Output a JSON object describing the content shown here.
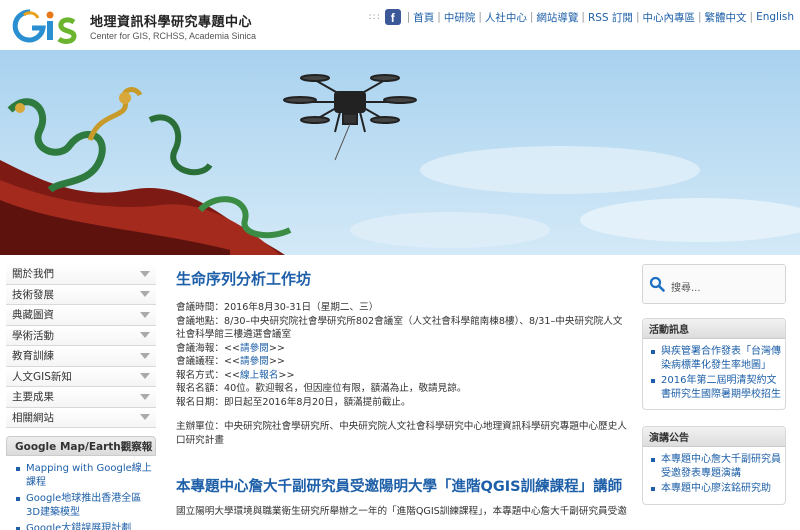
{
  "header": {
    "logo_text": "GIS",
    "title": "地理資訊科學研究專題中心",
    "subtitle": "Center for GIS, RCHSS, Academia Sinica",
    "nav": [
      "首頁",
      "中研院",
      "人社中心",
      "網站導覽",
      "RSS 訂閱",
      "中心內專區",
      "繁體中文",
      "English"
    ]
  },
  "left_menu": [
    "關於我們",
    "技術發展",
    "典藏圖資",
    "學術活動",
    "教育訓練",
    "人文GIS新知",
    "主要成果",
    "相關網站"
  ],
  "gmap": {
    "title": "Google Map/Earth觀察報",
    "items": [
      "Mapping with Google線上課程",
      "Google地球推出香港全區3D建築模型",
      "Google大錯誤展現計劃"
    ]
  },
  "main": {
    "post1": {
      "title": "生命序列分析工作坊",
      "lines": [
        {
          "text": "會議時間：2016年8月30-31日（星期二、三）"
        },
        {
          "text": "會議地點：8/30–中央研究院社會學研究所802會議室（人文社會科學館南棟8樓）、8/31–中央研究院人文社會科學館三樓遴選會議室"
        },
        {
          "prefix": "會議海報：<<",
          "link": "請參閱",
          "suffix": ">>"
        },
        {
          "prefix": "會議議程：<<",
          "link": "請參閱",
          "suffix": ">>"
        },
        {
          "prefix": "報名方式：<<",
          "link": "線上報名",
          "suffix": ">>"
        },
        {
          "text": "報名名額：40位。歡迎報名，但因座位有限，額滿為止，敬請見諒。"
        },
        {
          "text": "報名日期：即日起至2016年8月20日，額滿提前截止。"
        }
      ],
      "organizer": "主辦單位：中央研究院社會學研究所、中央研究院人文社會科學研究中心地理資訊科學研究專題中心歷史人口研究計畫"
    },
    "post2": {
      "title": "本專題中心詹大千副研究員受邀陽明大學「進階QGIS訓練課程」講師",
      "excerpt": "國立陽明大學環境與職業衛生研究所舉辦之一年的「進階QGIS訓練課程」，本專題中心詹大千副研究員受邀"
    }
  },
  "right": {
    "search_placeholder": "搜尋...",
    "activity": {
      "title": "活動訊息",
      "items": [
        "與疾管署合作發表「台灣傳染病標準化發生率地圖」",
        "2016年第二屆明清契約文書研究生國際暑期學校招生"
      ]
    },
    "lectures": {
      "title": "演講公告",
      "items": [
        "本專題中心詹大千副研究員受邀發表專題演講",
        "本專題中心廖泫銘研究助"
      ]
    }
  },
  "colors": {
    "link": "#1d5fa8",
    "sky": "#b8daf0",
    "roof": "#8c1d16"
  }
}
